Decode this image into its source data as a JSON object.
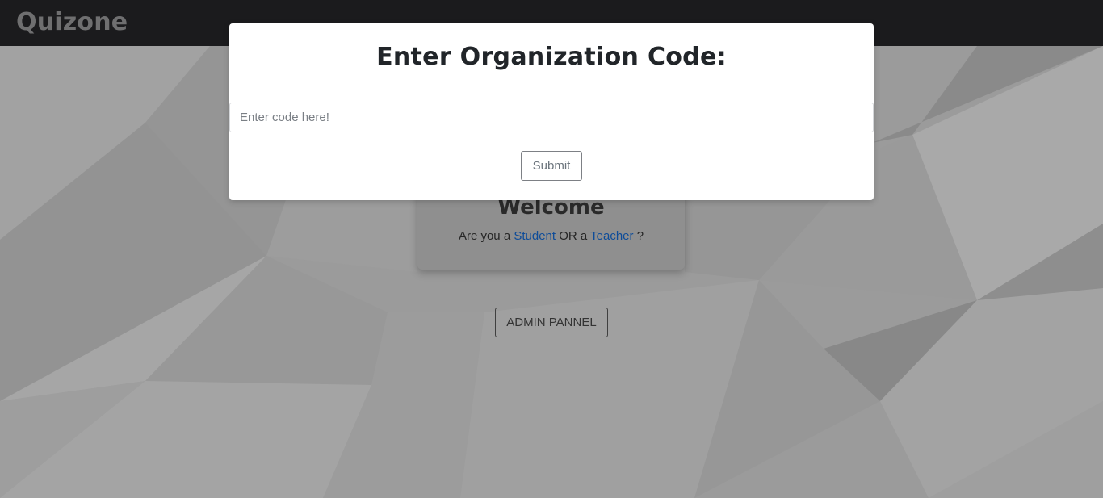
{
  "app": {
    "brand": "Quizone"
  },
  "modal": {
    "title": "Enter Organization Code:",
    "input_placeholder": "Enter code here!",
    "input_value": "",
    "submit_label": "Submit"
  },
  "welcome": {
    "title": "Welcome",
    "prefix": "Are you a",
    "student_label": "Student",
    "or_text": "OR a",
    "teacher_label": "Teacher",
    "suffix": "?"
  },
  "admin": {
    "button_label": "ADMIN PANNEL"
  },
  "colors": {
    "navbar": "#1b1b1d",
    "brand": "#6f6f70",
    "link": "#0e4c99",
    "modal_bg": "#ffffff"
  }
}
